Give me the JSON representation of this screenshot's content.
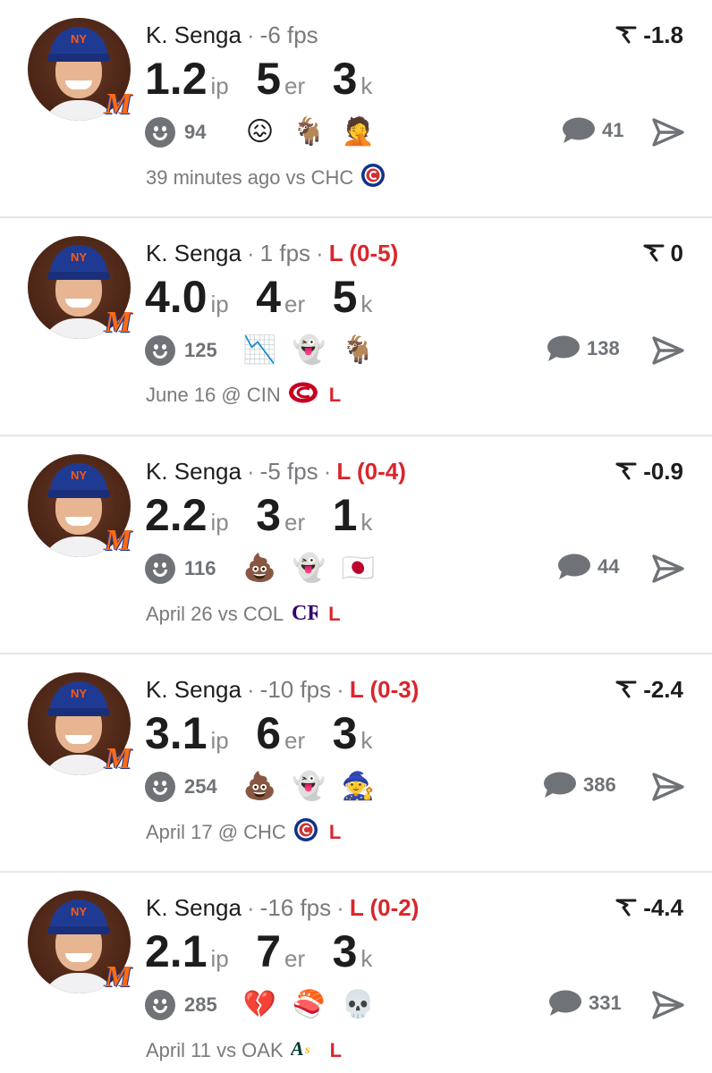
{
  "cards": [
    {
      "name": "K. Senga",
      "fps": "-6 fps",
      "record": "",
      "delta": "-1.8",
      "ip": "1.2",
      "er": "5",
      "k": "3",
      "units": {
        "ip": "ip",
        "er": "er",
        "k": "k"
      },
      "reactions": "94",
      "emojis": [
        "😖",
        "🐐",
        "🤦"
      ],
      "comments": "41",
      "when": "39 minutes ago vs CHC",
      "opponent_logo": "cubs-logo",
      "result": ""
    },
    {
      "name": "K. Senga",
      "fps": "1 fps",
      "record": "L (0-5)",
      "delta": "0",
      "ip": "4.0",
      "er": "4",
      "k": "5",
      "units": {
        "ip": "ip",
        "er": "er",
        "k": "k"
      },
      "reactions": "125",
      "emojis": [
        "📉",
        "👻",
        "🐐"
      ],
      "comments": "138",
      "when": "June 16 @ CIN",
      "opponent_logo": "reds-logo",
      "result": "L"
    },
    {
      "name": "K. Senga",
      "fps": "-5 fps",
      "record": "L (0-4)",
      "delta": "-0.9",
      "ip": "2.2",
      "er": "3",
      "k": "1",
      "units": {
        "ip": "ip",
        "er": "er",
        "k": "k"
      },
      "reactions": "116",
      "emojis": [
        "💩",
        "👻",
        "🇯🇵"
      ],
      "comments": "44",
      "when": "April 26 vs COL",
      "opponent_logo": "rockies-logo",
      "result": "L"
    },
    {
      "name": "K. Senga",
      "fps": "-10 fps",
      "record": "L (0-3)",
      "delta": "-2.4",
      "ip": "3.1",
      "er": "6",
      "k": "3",
      "units": {
        "ip": "ip",
        "er": "er",
        "k": "k"
      },
      "reactions": "254",
      "emojis": [
        "💩",
        "👻",
        "🧙"
      ],
      "comments": "386",
      "when": "April 17 @ CHC",
      "opponent_logo": "cubs-logo",
      "result": "L"
    },
    {
      "name": "K. Senga",
      "fps": "-16 fps",
      "record": "L (0-2)",
      "delta": "-4.4",
      "ip": "2.1",
      "er": "7",
      "k": "3",
      "units": {
        "ip": "ip",
        "er": "er",
        "k": "k"
      },
      "reactions": "285",
      "emojis": [
        "💔",
        "🍣",
        "💀"
      ],
      "comments": "331",
      "when": "April 11 vs OAK",
      "opponent_logo": "athletics-logo",
      "result": "L"
    }
  ],
  "colors": {
    "loss": "#d9262c",
    "muted": "#6f7377",
    "text": "#1d1d1f"
  }
}
